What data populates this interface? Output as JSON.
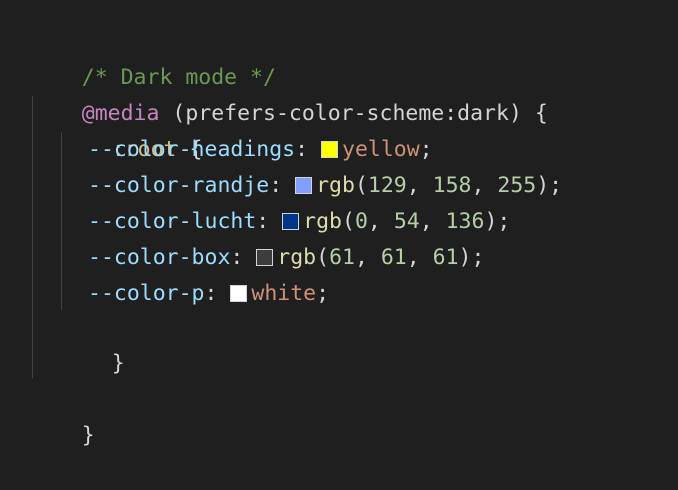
{
  "code": {
    "comment": "/* Dark mode */",
    "media_keyword": "@media",
    "media_query": " (prefers-color-scheme:dark) {",
    "root_selector": ":root",
    "root_open": " {",
    "declarations": [
      {
        "prop": "--color-headings",
        "colon": ": ",
        "value_kind": "keyword",
        "keyword": "yellow",
        "swatch": "#ffff00",
        "semi": ";"
      },
      {
        "prop": "--color-randje",
        "colon": ": ",
        "value_kind": "rgb",
        "fn": "rgb",
        "open": "(",
        "args": [
          "129",
          "158",
          "255"
        ],
        "close": ")",
        "swatch": "#819eff",
        "semi": ";"
      },
      {
        "prop": "--color-lucht",
        "colon": ": ",
        "value_kind": "rgb",
        "fn": "rgb",
        "open": "(",
        "args": [
          "0",
          "54",
          "136"
        ],
        "close": ")",
        "swatch": "#003688",
        "semi": ";"
      },
      {
        "prop": "--color-box",
        "colon": ": ",
        "value_kind": "rgb",
        "fn": "rgb",
        "open": "(",
        "args": [
          "61",
          "61",
          "61"
        ],
        "close": ")",
        "swatch": "#3d3d3d",
        "semi": ";"
      },
      {
        "prop": "--color-p",
        "colon": ": ",
        "value_kind": "keyword",
        "keyword": "white",
        "swatch": "#ffffff",
        "semi": ";"
      }
    ],
    "root_close": "}",
    "media_close": "}"
  },
  "theme": {
    "background": "#1f1f1f",
    "comment": "#6a9955",
    "at_rule": "#c586c0",
    "selector": "#d7ba7d",
    "property": "#9cdcfe",
    "string_keyword": "#ce9178",
    "function": "#dcdcaa",
    "number": "#b5cea8"
  }
}
